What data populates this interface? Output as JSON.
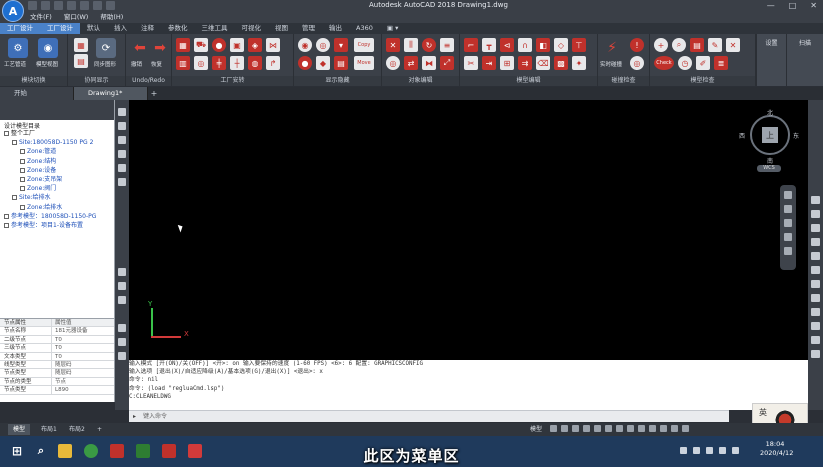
{
  "window": {
    "app_logo_letter": "A",
    "title": "Autodesk AutoCAD 2018   Drawing1.dwg",
    "minimize": "—",
    "maximize": "□",
    "close": "✕"
  },
  "menubar": [
    "文件(F)",
    "窗口(W)",
    "帮助(H)"
  ],
  "ribbon_tabs": [
    "工厂设计",
    "工厂设计",
    "默认",
    "插入",
    "注释",
    "参数化",
    "三维工具",
    "可视化",
    "视图",
    "管理",
    "输出",
    "A360",
    "▣ ▾"
  ],
  "ribbon_panels": {
    "module_switch": {
      "label": "模块切换",
      "tools": [
        "工艺管道",
        "模型视图"
      ]
    },
    "coop_display": {
      "label": "协同显示",
      "tools": [
        "同步图形"
      ]
    },
    "undo_redo": {
      "label": "Undo/Redo",
      "tools": [
        "撤销",
        "恢复"
      ]
    },
    "factory_layout": {
      "label": "工厂安转"
    },
    "display_hide": {
      "label": "显示隐藏"
    },
    "object_edit": {
      "label": "对象编辑"
    },
    "model_edit": {
      "label": "模型编辑"
    },
    "collision_check": {
      "label": "碰撞检查",
      "tools": [
        "实时碰撞"
      ]
    },
    "model_check": {
      "label": "模型检查",
      "tools": [
        "Check"
      ]
    },
    "settings": {
      "label": "设置"
    },
    "misc": {
      "label": "扫描"
    },
    "copy_label": "Copy",
    "move_label": "Move"
  },
  "file_tabs": {
    "start": "开始",
    "drawing": "Drawing1*",
    "add": "+"
  },
  "tree": {
    "title": "设计模型目录",
    "items": [
      {
        "text": "整个工厂",
        "level": 0
      },
      {
        "text": "Site:180058D-1150 PG 2",
        "level": 1
      },
      {
        "text": "Zone:管道",
        "level": 2
      },
      {
        "text": "Zone:结构",
        "level": 2
      },
      {
        "text": "Zone:设备",
        "level": 2
      },
      {
        "text": "Zone:支吊架",
        "level": 2
      },
      {
        "text": "Zone:阀门",
        "level": 2
      },
      {
        "text": "Site:给排水",
        "level": 1
      },
      {
        "text": "Zone:给排水",
        "level": 2
      },
      {
        "text": "参考模型：180058D-1150-PG",
        "level": 0
      },
      {
        "text": "参考模型：项目1-设备布置",
        "level": 0
      }
    ]
  },
  "properties": {
    "header": [
      "节点属性",
      "属性值"
    ],
    "rows": [
      [
        "节点名称",
        "181元器设备"
      ],
      [
        "二级节点",
        "T0"
      ],
      [
        "三级节点",
        "T0"
      ],
      [
        "文本类型",
        "T0"
      ],
      [
        "线型类型",
        "随层码"
      ],
      [
        "节点类型",
        "随层码"
      ],
      [
        "节点的类型",
        "节点"
      ],
      [
        "节点类型",
        "L890"
      ]
    ]
  },
  "viewcube": {
    "north": "北",
    "south": "南",
    "east": "东",
    "west": "西",
    "top": "上",
    "wcs": "WCS"
  },
  "ucs": {
    "x": "X",
    "y": "Y"
  },
  "command": {
    "lines": [
      "输入模式 [开(ON)/关(OFF)] <开>: on 输入要保持的速度 (1-60 FPS) <6>: 6 配置:  GRAPHICSCONFIG",
      "输入选项 [退出(X)/自适应降级(A)/基本选项(G)/退出(X)] <退出>: x",
      "命令: nil",
      "命令: (load \"regluaCmd.lsp\")",
      "C:CLEANELDWG"
    ],
    "placeholder": "键入命令"
  },
  "layout_tabs": [
    "模型",
    "布局1",
    "布局2",
    "+"
  ],
  "status": {
    "model_label": "模型"
  },
  "taskbar": {
    "start_glyph": "⊞",
    "search_glyph": "⌕",
    "time": "18:04",
    "date": "2020/4/12",
    "ime": "英"
  },
  "subtitle": "此区为菜单区",
  "colors": {
    "accent": "#4a82c9",
    "tool_red": "#c0312b",
    "canvas": "#000000"
  }
}
